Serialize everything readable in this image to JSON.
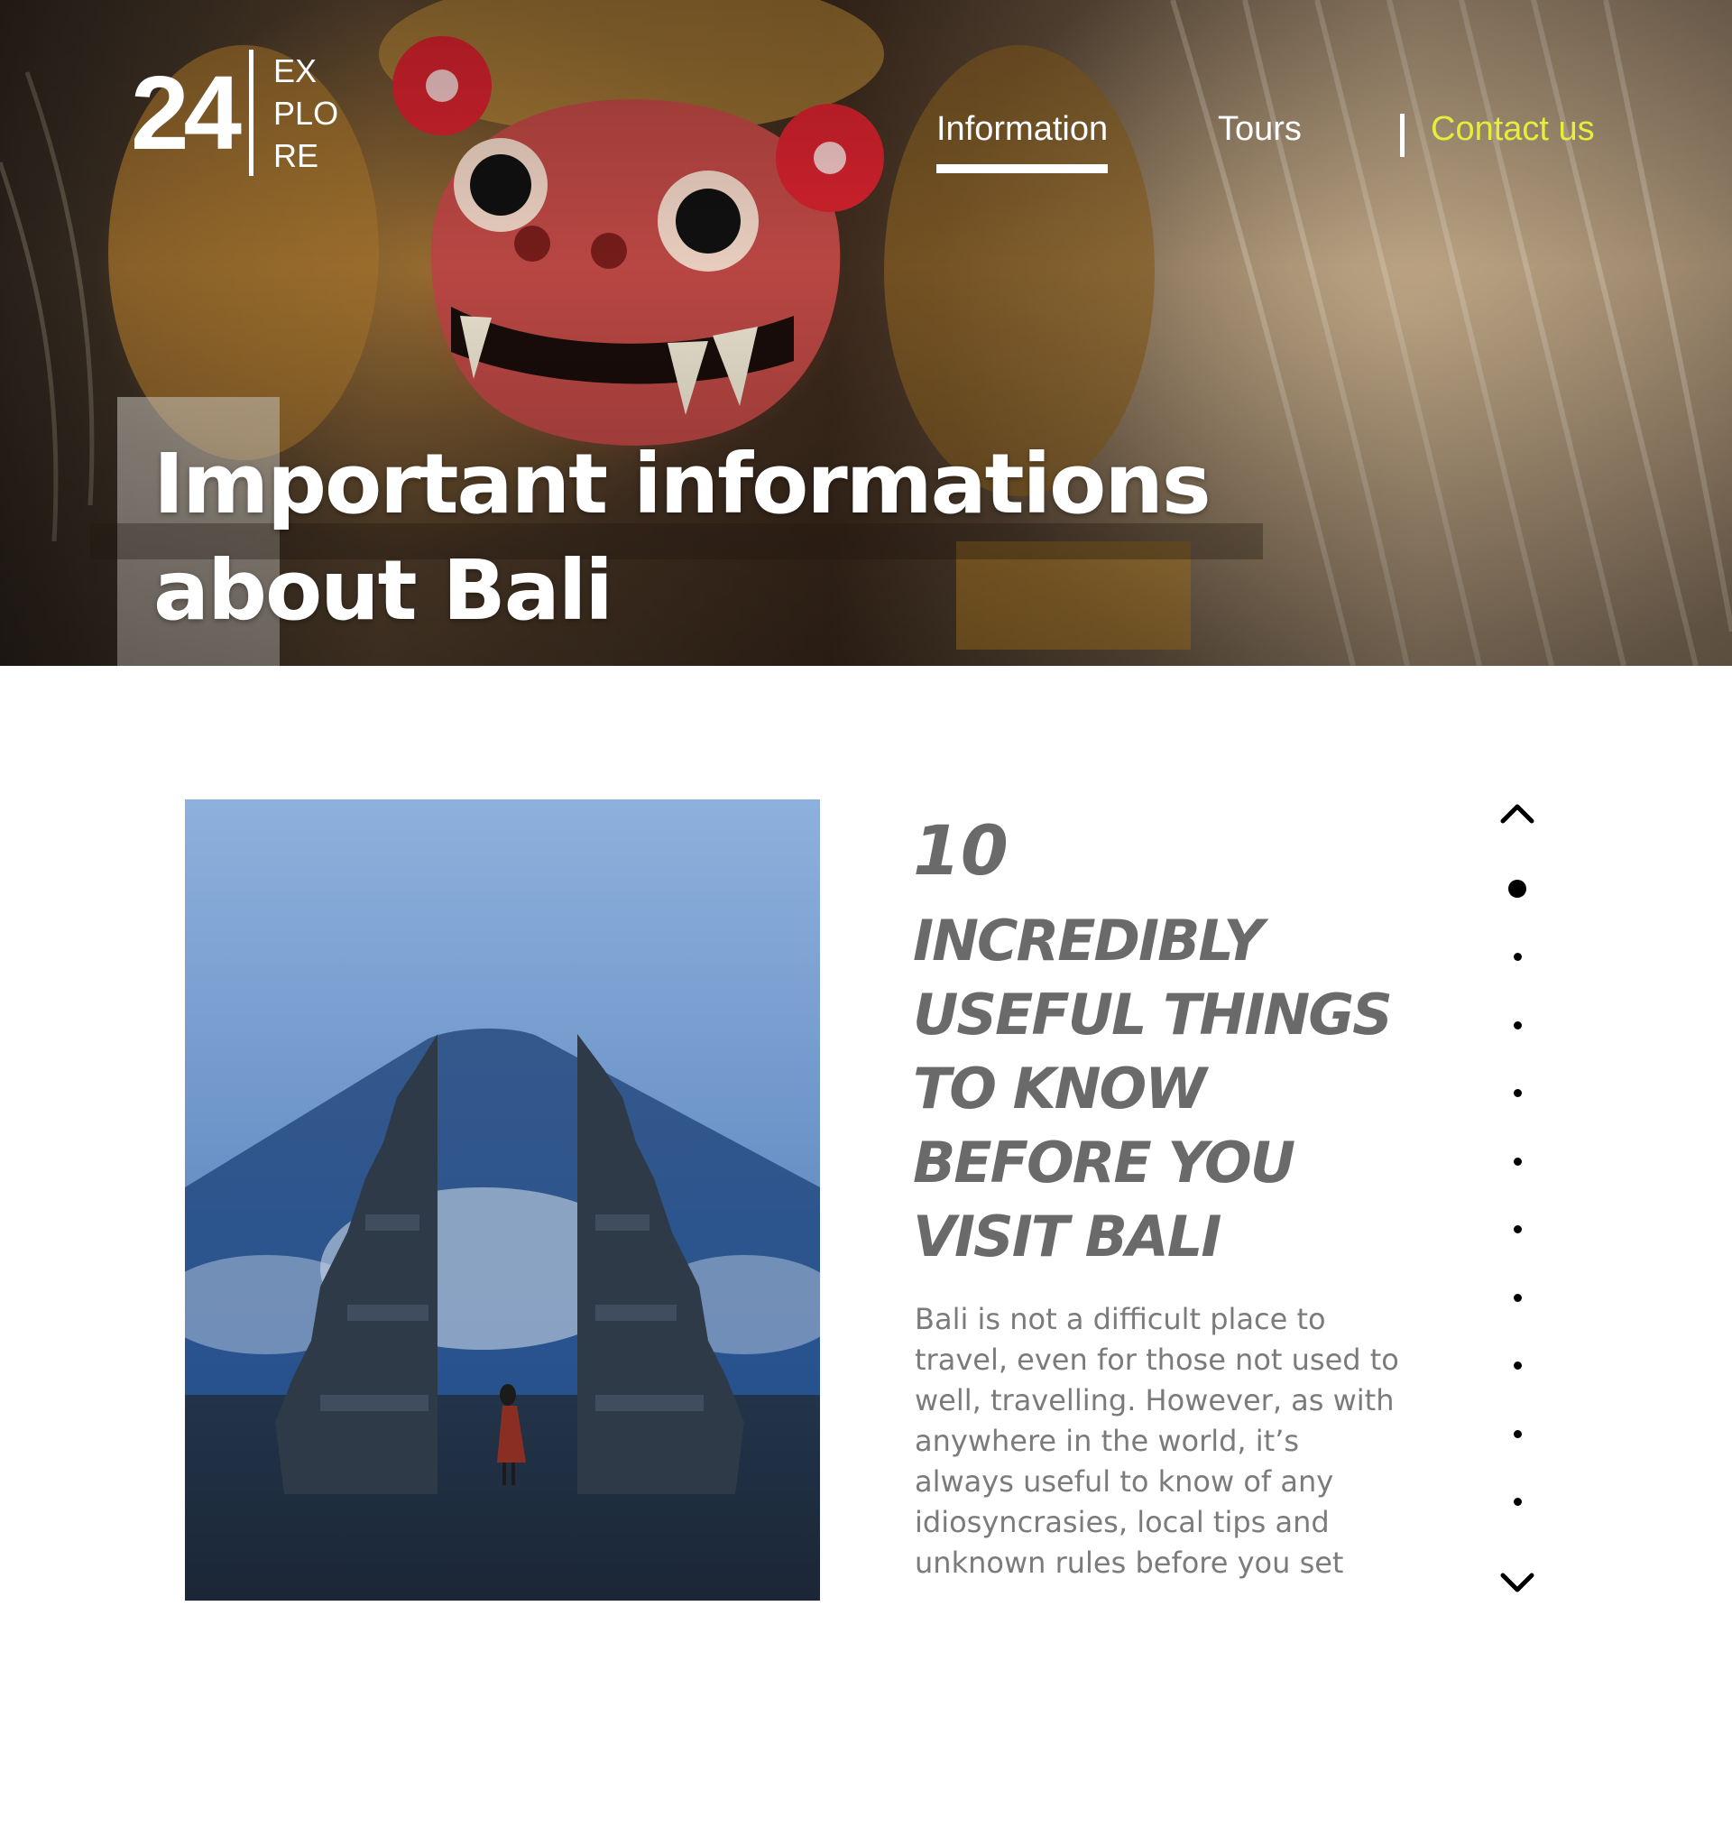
{
  "logo": {
    "number": "24",
    "words": [
      "EX",
      "PLO",
      "RE"
    ]
  },
  "nav": {
    "items": [
      {
        "label": "Information",
        "active": true
      },
      {
        "label": "Tours",
        "active": false
      },
      {
        "label": "Contact us",
        "active": false
      }
    ],
    "accent_color": "#e3ef3a"
  },
  "hero": {
    "title_lines": [
      "Important informations",
      "about Bali"
    ]
  },
  "article": {
    "number": "10",
    "headline_lines": [
      "INCREDIBLY",
      "USEFUL THINGS",
      "TO KNOW",
      "BEFORE YOU",
      "VISIT BALI"
    ],
    "body_lines": [
      "Bali is not a difficult place to",
      "travel, even for those not used to",
      "well, travelling. However, as with",
      "anywhere in the world, it’s",
      "always useful to know of any",
      "idiosyncrasies, local tips and",
      "unknown rules before you set"
    ],
    "text_color": "#6a6a6a"
  },
  "pager": {
    "total": 10,
    "current": 1,
    "up_icon": "chevron-up-icon",
    "down_icon": "chevron-down-icon"
  }
}
